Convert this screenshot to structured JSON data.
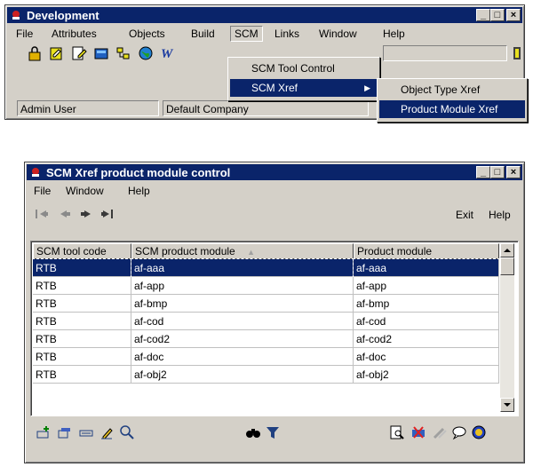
{
  "window1": {
    "title": "Development",
    "menus": [
      "File",
      "Attributes",
      "Objects",
      "Build",
      "SCM",
      "Links",
      "Window",
      "Help"
    ],
    "status": {
      "user": "Admin User",
      "company": "Default Company"
    },
    "scm_menu": {
      "items": [
        "SCM Tool Control",
        "SCM Xref"
      ],
      "submenu_arrow": "▶"
    },
    "xref_submenu": {
      "items": [
        "Object Type Xref",
        "Product Module Xref"
      ]
    },
    "toolbar_icons": [
      "lock-icon",
      "new-object-icon",
      "edit-icon",
      "database-icon",
      "tree-icon",
      "globe-icon",
      "w-icon",
      "exit-door-icon"
    ],
    "toolbar_w": "W"
  },
  "window2": {
    "title": "SCM Xref product module control",
    "menus": [
      "File",
      "Window",
      "Help"
    ],
    "nav": {
      "first": "|◆",
      "prev": "◆",
      "next": "◆",
      "last": "◆|"
    },
    "buttons": {
      "exit": "Exit",
      "help": "Help"
    },
    "columns": [
      "SCM tool code",
      "SCM product module",
      "Product module"
    ],
    "sort_indicator": "▲",
    "rows": [
      [
        "RTB",
        "af-aaa",
        "af-aaa"
      ],
      [
        "RTB",
        "af-app",
        "af-app"
      ],
      [
        "RTB",
        "af-bmp",
        "af-bmp"
      ],
      [
        "RTB",
        "af-cod",
        "af-cod"
      ],
      [
        "RTB",
        "af-cod2",
        "af-cod2"
      ],
      [
        "RTB",
        "af-doc",
        "af-doc"
      ],
      [
        "RTB",
        "af-obj2",
        "af-obj2"
      ]
    ],
    "bottom_icons": [
      "add-record-icon",
      "copy-record-icon",
      "modify-record-icon",
      "edit-pencil-icon",
      "search-icon",
      "binoculars-icon",
      "filter-icon",
      "preview-icon",
      "delete-icon",
      "tools-icon",
      "comment-icon",
      "info-icon"
    ]
  },
  "colors": {
    "title_bar": "#0a246a",
    "selection": "#0a246a",
    "face": "#d4d0c8"
  }
}
